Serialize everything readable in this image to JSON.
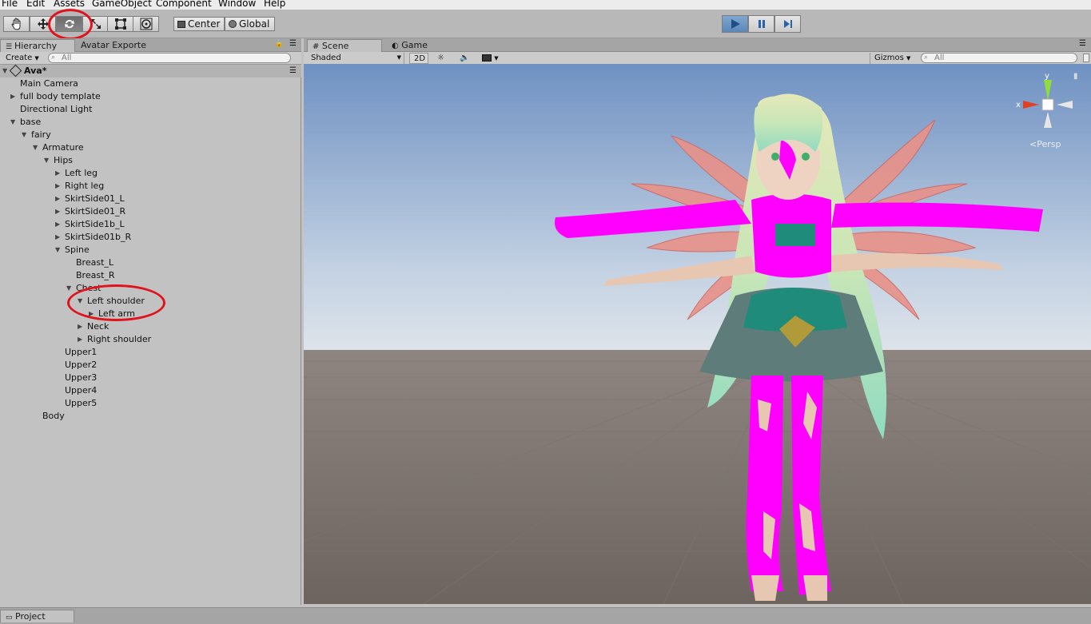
{
  "menu": [
    "File",
    "Edit",
    "Assets",
    "GameObject",
    "Component",
    "Window",
    "Help"
  ],
  "toolbar": {
    "tools": [
      "hand-tool",
      "move-tool",
      "rotate-tool",
      "scale-tool",
      "rect-tool",
      "transform-tool"
    ],
    "active_tool": "rotate-tool",
    "pivot_label": "Center",
    "space_label": "Global"
  },
  "play_controls": {
    "play_active": true
  },
  "hierarchy": {
    "tabs": [
      "Hierarchy",
      "Avatar Exporte"
    ],
    "create_label": "Create",
    "search_placeholder": "All",
    "scene_name": "Ava*",
    "items": [
      "Main Camera",
      "full body template",
      "Directional Light",
      "base",
      "fairy",
      "Armature",
      "Hips",
      "Left leg",
      "Right leg",
      "SkirtSide01_L",
      "SkirtSide01_R",
      "SkirtSide1b_L",
      "SkirtSide01b_R",
      "Spine",
      "Breast_L",
      "Breast_R",
      "Chest",
      "Left shoulder",
      "Left arm",
      "Neck",
      "Right shoulder",
      "Upper1",
      "Upper2",
      "Upper3",
      "Upper4",
      "Upper5",
      "Body"
    ]
  },
  "scene": {
    "tabs": [
      "Scene",
      "Game"
    ],
    "shading_mode": "Shaded",
    "mode_2d": "2D",
    "gizmos_label": "Gizmos",
    "search_placeholder": "All",
    "gizmo_axes": {
      "x": "x",
      "y": "y"
    },
    "projection": "Persp"
  },
  "bottom": {
    "project_tab": "Project"
  },
  "colors": {
    "annotation": "#e0131c",
    "play_active": "#5b88b9",
    "missing_material": "#ff00ff"
  }
}
